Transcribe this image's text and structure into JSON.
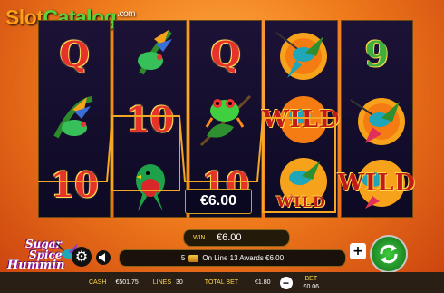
{
  "watermark": {
    "slot": "Slot",
    "catalog": "Catalog",
    "tld": ".com"
  },
  "reels": [
    [
      {
        "type": "text",
        "value": "Q"
      },
      {
        "type": "icon",
        "name": "bird-of-paradise-frog"
      },
      {
        "type": "text",
        "value": "10"
      }
    ],
    [
      {
        "type": "icon",
        "name": "bird-of-paradise-frog"
      },
      {
        "type": "text",
        "value": "10"
      },
      {
        "type": "icon",
        "name": "quetzal-bird"
      }
    ],
    [
      {
        "type": "text",
        "value": "Q"
      },
      {
        "type": "icon",
        "name": "tree-frog"
      },
      {
        "type": "text",
        "value": "10"
      }
    ],
    [
      {
        "type": "icon",
        "name": "hummingbird"
      },
      {
        "type": "wild",
        "value": "WILD"
      },
      {
        "type": "wild",
        "value": "WILD"
      }
    ],
    [
      {
        "type": "text",
        "value": "9"
      },
      {
        "type": "icon",
        "name": "hummingbird"
      },
      {
        "type": "wild",
        "value": "WILD"
      }
    ]
  ],
  "win_popup": "€6.00",
  "win_display": {
    "label": "WIN",
    "value": "€6.00"
  },
  "line_message": {
    "count": "5",
    "text": "On Line 13 Awards €6.00"
  },
  "bottom": {
    "cash_label": "CASH",
    "cash_value": "€501.75",
    "lines_label": "LINES",
    "lines_value": "30",
    "total_bet_label": "TOTAL BET",
    "total_bet_value": "€1.80",
    "bet_label": "BET",
    "bet_value": "€0.06"
  },
  "game_title": {
    "line1": "Sugar",
    "line2": "Spice",
    "line3": "Hummin"
  },
  "icons": {
    "settings": "gear-icon",
    "sound": "speaker-icon",
    "plus": "plus-icon",
    "spin": "spin-arrows-icon",
    "minus": "minus-icon"
  },
  "colors": {
    "accent": "#f07c1c",
    "win_line": "#f5a623",
    "spin": "#2fb82f"
  }
}
